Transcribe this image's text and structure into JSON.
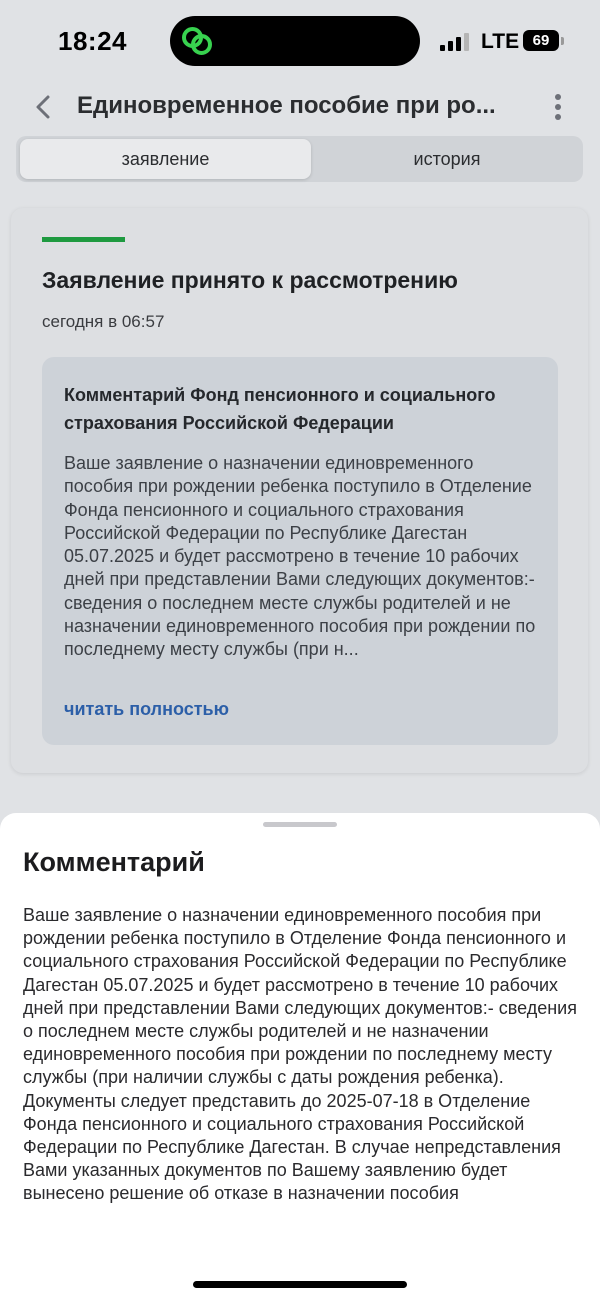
{
  "status_bar": {
    "time": "18:24",
    "network": "LTE",
    "battery": "69",
    "island_icon": "green-link-icon"
  },
  "header": {
    "title": "Единовременное пособие при ро...",
    "back_icon": "chevron-left-icon",
    "menu_icon": "more-vertical-icon"
  },
  "tabs": [
    {
      "label": "заявление",
      "active": true
    },
    {
      "label": "история",
      "active": false
    }
  ],
  "card": {
    "status_color": "#1e9a40",
    "status_title": "Заявление принято к рассмотрению",
    "date": "сегодня в 06:57",
    "comment_org": "Комментарий Фонд пенсионного и социального страхования Российской Федерации",
    "comment_preview": "Ваше заявление о назначении единовременного пособия при рождении ребенка поступило в Отделение Фонда пенсионного и социального страхования Российской Федерации по Республике Дагестан 05.07.2025 и будет рассмотрено в течение 10 рабочих дней при представлении Вами следующих документов:- сведения о последнем месте службы родителей и не назначении единовременного пособия при рождении по последнему месту службы (при н...",
    "read_more": "читать полностью"
  },
  "sheet": {
    "title": "Комментарий",
    "text": "Ваше заявление о назначении единовременного пособия при рождении ребенка поступило в Отделение Фонда пенсионного и социального страхования Российской Федерации по Республике Дагестан 05.07.2025 и будет рассмотрено в течение 10 рабочих дней при представлении Вами следующих документов:- сведения о последнем месте службы родителей и не назначении единовременного пособия при рождении по последнему месту службы (при наличии службы с даты рождения ребенка). Документы следует представить до 2025-07-18 в Отделение Фонда пенсионного и социального страхования Российской Федерации по Республике Дагестан. В случае непредставления Вами указанных документов по Вашему заявлению будет вынесено решение об отказе в назначении пособия"
  }
}
